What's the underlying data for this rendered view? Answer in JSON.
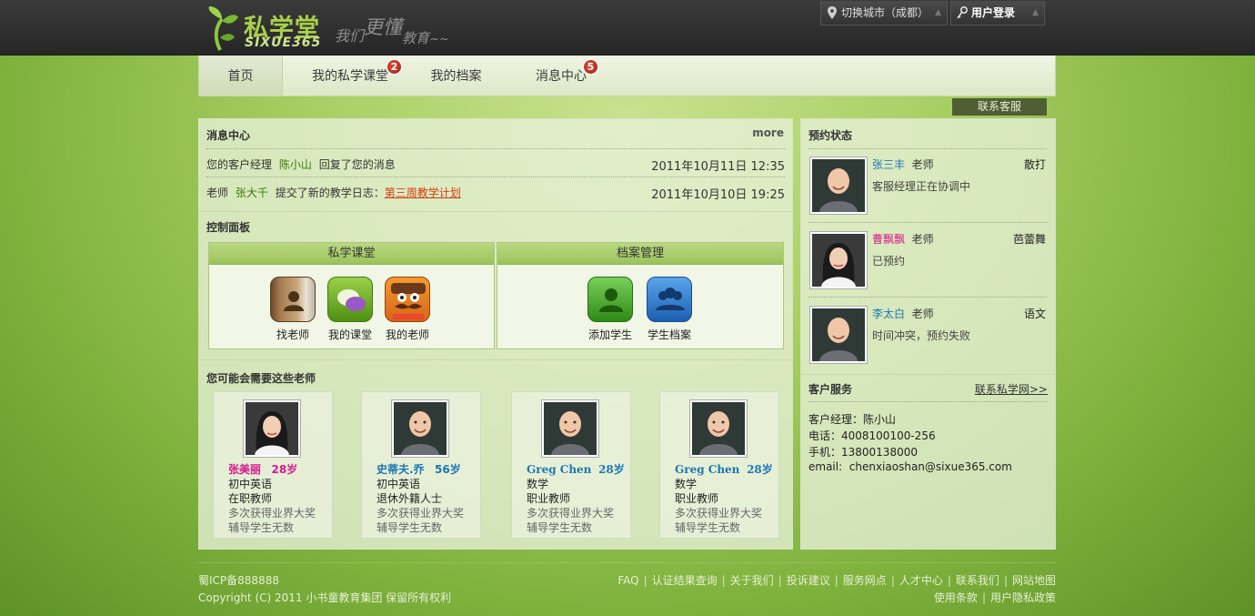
{
  "brand": {
    "name_cn": "私学堂",
    "name_en": "SIXUE365",
    "slogan": [
      "我们",
      "更懂",
      "教育",
      "~~"
    ]
  },
  "topbar": {
    "city_label": "切换城市（成都）",
    "login_label": "用户登录"
  },
  "nav": {
    "items": [
      {
        "label": "首页",
        "active": true
      },
      {
        "label": "我的私学课堂",
        "badge": "2"
      },
      {
        "label": "我的档案"
      },
      {
        "label": "消息中心",
        "badge": "5"
      }
    ]
  },
  "contact_service": "联系客服",
  "messages": {
    "title": "消息中心",
    "more": "more",
    "items": [
      {
        "prefix": "您的客户经理",
        "name": "陈小山",
        "text": "回复了您的消息",
        "link": "",
        "time": "2011年10月11日 12:35"
      },
      {
        "prefix": "老师",
        "name": "张大千",
        "text": "提交了新的教学日志：",
        "link": "第三周教学计划",
        "time": "2011年10月10日 19:25"
      }
    ]
  },
  "control_panel": {
    "title": "控制面板",
    "groups": [
      {
        "title": "私学课堂",
        "buttons": [
          "找老师",
          "我的课堂",
          "我的老师"
        ]
      },
      {
        "title": "档案管理",
        "buttons": [
          "添加学生",
          "学生档案"
        ]
      }
    ]
  },
  "suggested": {
    "title": "您可能会需要这些老师",
    "teachers": [
      {
        "name": "张美丽",
        "age": "28岁",
        "line1": "初中英语",
        "line2": "在职教师",
        "line3": "多次获得业界大奖",
        "line4": "辅导学生无数",
        "name_color": "#d9178b"
      },
      {
        "name": "史蒂夫.乔",
        "age": "56岁",
        "line1": "初中英语",
        "line2": "退休外籍人士",
        "line3": "多次获得业界大奖",
        "line4": "辅导学生无数",
        "name_color": "#1b77b5"
      },
      {
        "name": "Greg Chen",
        "age": "28岁",
        "line1": "数学",
        "line2": "职业教师",
        "line3": "多次获得业界大奖",
        "line4": "辅导学生无数",
        "name_color": "#1b77b5"
      },
      {
        "name": "Greg Chen",
        "age": "28岁",
        "line1": "数学",
        "line2": "职业教师",
        "line3": "多次获得业界大奖",
        "line4": "辅导学生无数",
        "name_color": "#1b77b5"
      }
    ]
  },
  "bookings": {
    "title": "预约状态",
    "items": [
      {
        "name": "张三丰",
        "role": "老师",
        "subject": "散打",
        "status": "客服经理正在协调中",
        "name_color": "#1b77b5"
      },
      {
        "name": "曹飘飘",
        "role": "老师",
        "subject": "芭蕾舞",
        "status": "已预约",
        "name_color": "#d9178b"
      },
      {
        "name": "李太白",
        "role": "老师",
        "subject": "语文",
        "status": "时间冲突，预约失败",
        "name_color": "#1b77b5"
      }
    ]
  },
  "customer_service": {
    "title": "客户服务",
    "link": "联系私学网>>",
    "lines": [
      "客户经理：陈小山",
      "电话：4008100100-256",
      "手机：13800138000",
      "email:  chenxiaoshan@sixue365.com"
    ]
  },
  "footer": {
    "icp": "蜀ICP备888888",
    "copyright": "Copyright (C) 2011 小书童教育集团 保留所有权利",
    "links_row1": [
      "FAQ",
      "认证结果查询",
      "关于我们",
      "投诉建议",
      "服务网点",
      "人才中心",
      "联系我们",
      "网站地图"
    ],
    "links_row2": [
      "使用条款",
      "用户隐私政策"
    ]
  }
}
